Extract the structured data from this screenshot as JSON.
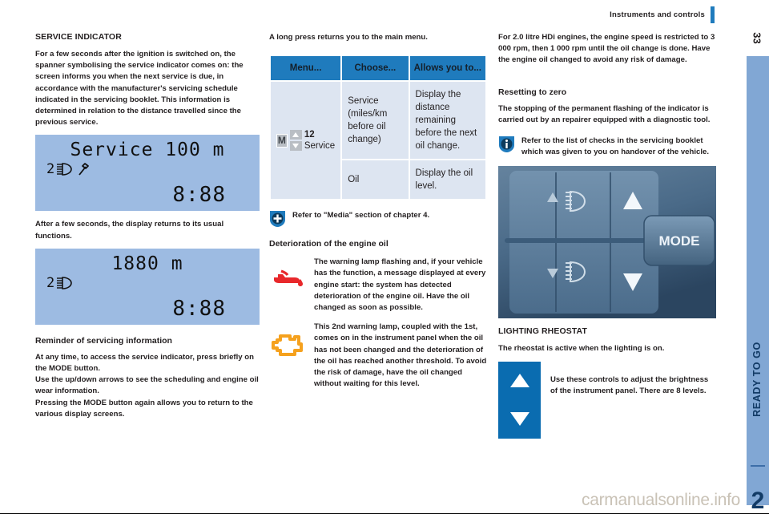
{
  "header": {
    "title": "Instruments and controls"
  },
  "rail": {
    "page_number": "33",
    "chapter_text": "READY TO GO",
    "chapter_number": "2"
  },
  "col1": {
    "heading": "SERVICE INDICATOR",
    "para1": "For a few seconds after the ignition is switched on, the spanner symbolising the service indicator comes on: the screen informs you when the next service is due, in accordance with the manufacturer's servicing schedule indicated in the servicing booklet. This information is determined in relation to the distance travelled since the previous service.",
    "lcd1": {
      "top": "Service 100 m",
      "left_prefix": "2",
      "clock": "8:88",
      "lamp": "headlamp-wrench-icon"
    },
    "para2": "After a few seconds, the display returns to its usual functions.",
    "lcd2": {
      "top": "1880 m",
      "left_prefix": "2",
      "clock": "8:88",
      "lamp": "headlamp-icon"
    },
    "heading2": "Reminder of servicing information",
    "para3": "At any time, to access the service indicator, press briefly on the MODE button.",
    "para4": "Use the up/down arrows to see the scheduling and engine oil wear information.",
    "para5": "Pressing the MODE button again allows you to return to the various display screens."
  },
  "col2": {
    "intro": "A long press returns you to the main menu.",
    "table": {
      "headers": [
        "Menu...",
        "Choose...",
        "Allows you to..."
      ],
      "menu_cell": {
        "m_letter": "M",
        "number": "12",
        "label": "Service"
      },
      "rows": [
        {
          "choose": "Service (miles/km before oil change)",
          "allows": "Display the distance remaining before the next oil change."
        },
        {
          "choose": "Oil",
          "allows": "Display the oil level."
        }
      ]
    },
    "callout": "Refer to \"Media\" section of chapter 4.",
    "heading": "Deterioration of the engine oil",
    "icon_items": [
      {
        "icon": "oil-can-warning-icon",
        "text": "The warning lamp flashing and, if your vehicle has the function, a message displayed at every engine start: the system has detected deterioration of the engine oil. Have the oil changed as soon as possible."
      },
      {
        "icon": "engine-warning-icon",
        "text": "This 2nd warning lamp, coupled with the 1st, comes on in the instrument panel when the oil has not been changed and the deterioration of the oil has reached another threshold. To avoid the risk of damage, have the oil changed without waiting for this level."
      }
    ]
  },
  "col3": {
    "para1": "For 2.0 litre HDi engines, the engine speed is restricted to 3 000 rpm, then 1 000 rpm until the oil change is done. Have the engine oil changed to avoid any risk of damage.",
    "heading": "Resetting to zero",
    "para2": "The stopping of the permanent flashing of the indicator is carried out by an repairer equipped with a diagnostic tool.",
    "callout": "Refer to the list of checks in the servicing booklet which was given to you on handover of the vehicle.",
    "photo": {
      "mode_label": "MODE",
      "alt": "instrument-panel-controls-photo"
    },
    "heading2": "LIGHTING RHEOSTAT",
    "para3": "The rheostat is active when the lighting is on.",
    "brightness_text": "Use these controls to adjust the brightness of the instrument panel. There are 8 levels."
  },
  "watermark": "carmanualsonline.info",
  "colors": {
    "accent": "#1f7bbd",
    "lcd": "#9dbbe2",
    "tab": "#81a7d4",
    "dark_blue": "#123b66",
    "warn_red": "#e8282b",
    "warn_orange": "#f5a11e"
  }
}
